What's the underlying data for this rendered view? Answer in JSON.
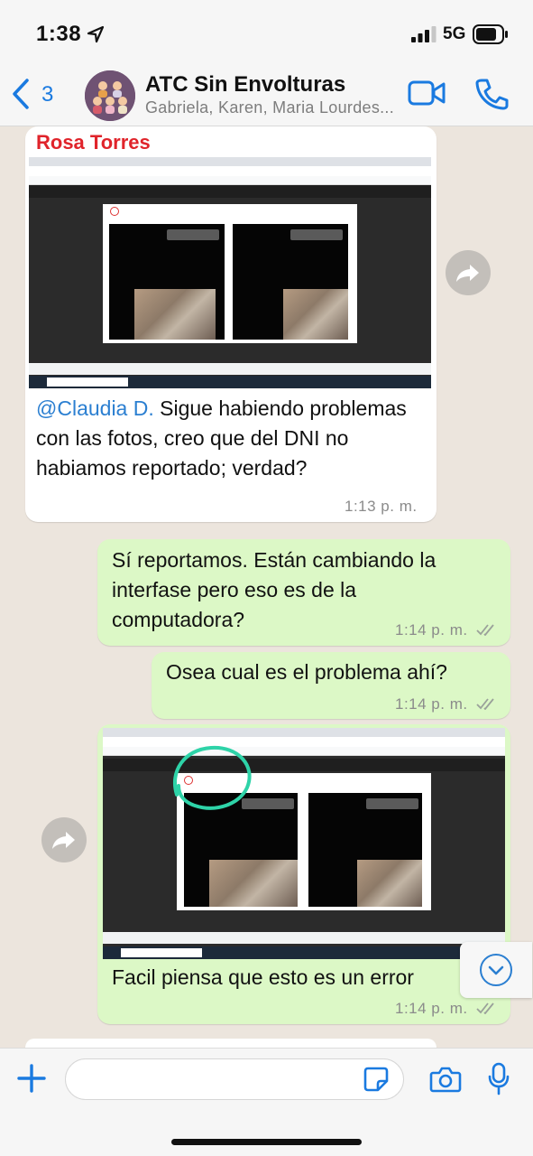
{
  "status_bar": {
    "time": "1:38",
    "network": "5G"
  },
  "header": {
    "back_count": "3",
    "title": "ATC Sin Envolturas",
    "members": "Gabriela, Karen, Maria Lourdes..."
  },
  "messages": [
    {
      "direction": "incoming",
      "sender": "Rosa Torres",
      "image": "screenshot",
      "mention": "@Claudia D.",
      "text": " Sigue habiendo problemas con las fotos, creo que del DNI no habiamos reportado; verdad?",
      "time": "1:13 p. m."
    },
    {
      "direction": "outgoing",
      "text": "Sí reportamos. Están cambiando la interfase pero eso es de la computadora?",
      "time": "1:14 p. m."
    },
    {
      "direction": "outgoing",
      "text": "Osea cual es el problema ahí?",
      "time": "1:14 p. m."
    },
    {
      "direction": "outgoing",
      "image": "screenshot",
      "text": "Facil piensa que esto es un error",
      "time": "1:14 p. m."
    }
  ],
  "composer": {
    "placeholder": ""
  },
  "colors": {
    "incoming_bubble": "#ffffff",
    "outgoing_bubble": "#dcf8c6",
    "accent": "#1a7ae0",
    "sender_name": "#e0242b",
    "annotation_circle": "#2ed3a8"
  },
  "icons": [
    "location-arrow-icon",
    "signal-icon",
    "battery-icon",
    "chevron-left-icon",
    "video-icon",
    "phone-icon",
    "forward-icon",
    "double-check-icon",
    "chevron-down-icon",
    "plus-icon",
    "sticker-icon",
    "camera-icon",
    "microphone-icon"
  ]
}
